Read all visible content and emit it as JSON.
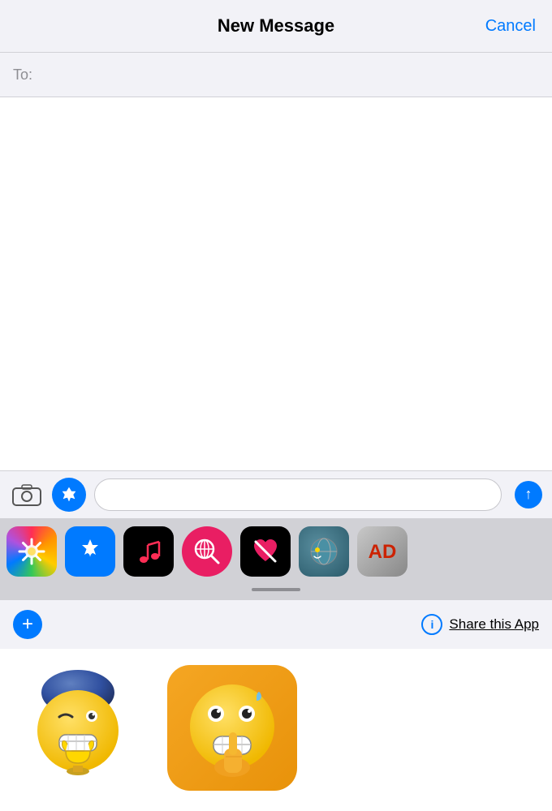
{
  "header": {
    "title": "New Message",
    "cancel_label": "Cancel"
  },
  "to_field": {
    "label": "To:",
    "placeholder": ""
  },
  "input_toolbar": {
    "message_placeholder": "",
    "send_label": "↑"
  },
  "app_strip": {
    "apps": [
      {
        "name": "Photos",
        "icon_class": "icon-photos",
        "emoji": "🌸"
      },
      {
        "name": "App Store",
        "icon_class": "icon-appstore",
        "emoji": "🅐"
      },
      {
        "name": "Music",
        "icon_class": "icon-music",
        "emoji": "♪"
      },
      {
        "name": "Web Search",
        "icon_class": "icon-web",
        "emoji": "🔍"
      },
      {
        "name": "Heart App",
        "icon_class": "icon-heart-black",
        "emoji": "♥"
      },
      {
        "name": "Globe App",
        "icon_class": "icon-globe",
        "emoji": "🌍"
      },
      {
        "name": "AD App",
        "icon_class": "icon-ad",
        "emoji": "A"
      }
    ]
  },
  "bottom_bar": {
    "plus_label": "+",
    "info_label": "i",
    "share_label": "Share this App"
  },
  "stickers": [
    {
      "name": "winking-trophy-emoji",
      "emoji": "😬🏆"
    },
    {
      "name": "scared-silence-emoji",
      "emoji": "😬🤫💧"
    }
  ]
}
